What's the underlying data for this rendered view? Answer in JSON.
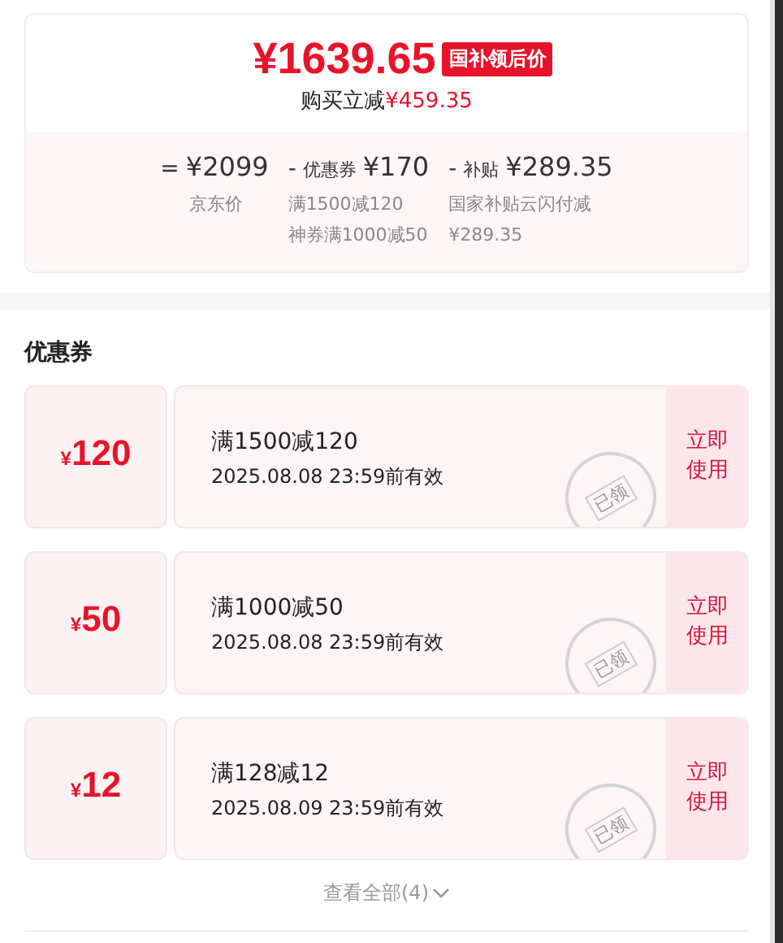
{
  "price_card": {
    "final_price": "¥1639.65",
    "badge": "国补领后价",
    "saving_label": "购买立减",
    "saving_amount": "¥459.35",
    "breakdown": [
      {
        "operator": "=",
        "value": "¥2099",
        "notes": [
          "京东价"
        ]
      },
      {
        "operator": "-",
        "label": "优惠券",
        "value": "¥170",
        "notes": [
          "满1500减120",
          "神券满1000减50"
        ]
      },
      {
        "operator": "-",
        "label": "补贴",
        "value": "¥289.35",
        "notes": [
          "国家补贴云闪付减",
          "¥289.35"
        ]
      }
    ]
  },
  "coupons_section": {
    "title": "优惠券",
    "coupons": [
      {
        "currency": "¥",
        "amount": "120",
        "condition": "满1500减120",
        "validity": "2025.08.08 23:59前有效",
        "stamp": "已领",
        "action": "立即使用"
      },
      {
        "currency": "¥",
        "amount": "50",
        "condition": "满1000减50",
        "validity": "2025.08.08 23:59前有效",
        "stamp": "已领",
        "action": "立即使用"
      },
      {
        "currency": "¥",
        "amount": "12",
        "condition": "满128减12",
        "validity": "2025.08.09 23:59前有效",
        "stamp": "已领",
        "action": "立即使用"
      }
    ],
    "view_all": "查看全部(4)"
  }
}
